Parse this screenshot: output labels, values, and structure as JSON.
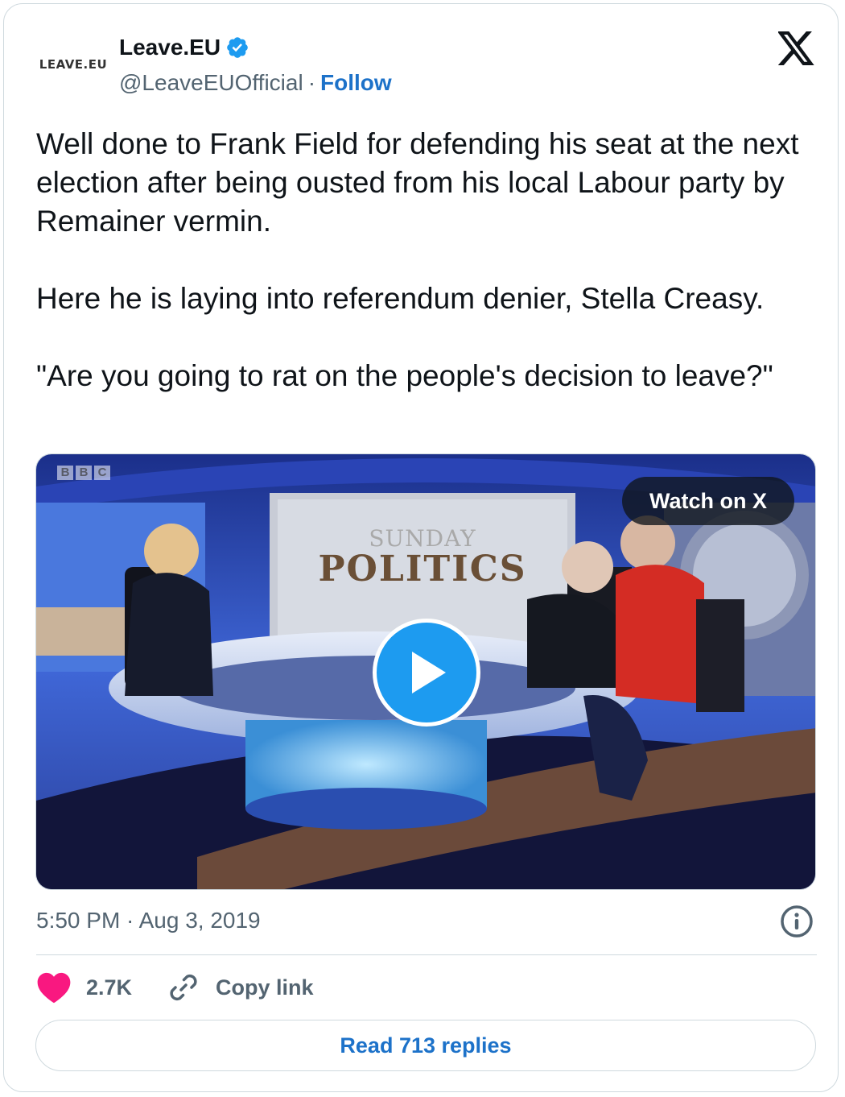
{
  "author": {
    "avatar_text": "LEAVE.EU",
    "display_name": "Leave.EU",
    "handle": "@LeaveEUOfficial",
    "separator": "·",
    "follow_label": "Follow",
    "verified_color": "#1d9bf0"
  },
  "platform_icon": "x-logo-icon",
  "tweet": {
    "text": "Well done to Frank Field for defending his seat at the next election after being ousted from his local Labour party by Remainer vermin.\n\nHere he is laying into referendum denier, Stella Creasy.\n\n\"Are you going to rat on the people's decision to leave?\""
  },
  "media": {
    "channel_logo": [
      "B",
      "B",
      "C"
    ],
    "show_title_line1": "SUNDAY",
    "show_title_line2": "POLITICS",
    "watch_label": "Watch on X",
    "play_icon": "play-icon"
  },
  "meta": {
    "timestamp": "5:50 PM · Aug 3, 2019",
    "info_icon": "info-icon"
  },
  "actions": {
    "like_count": "2.7K",
    "like_color": "#f91880",
    "copy_link_label": "Copy link"
  },
  "replies": {
    "label": "Read 713 replies"
  }
}
